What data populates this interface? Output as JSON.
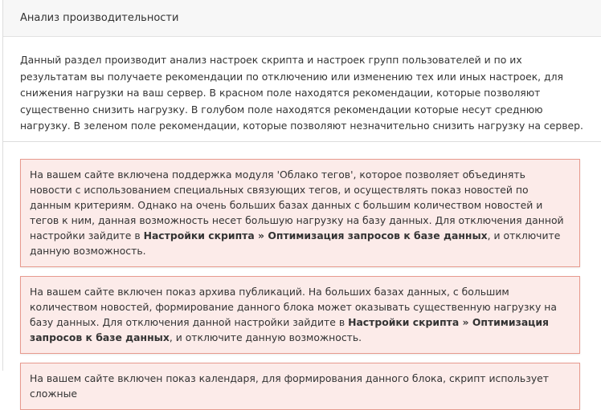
{
  "header": {
    "title": "Анализ производительности"
  },
  "intro": {
    "text": "Данный раздел производит анализ настроек скрипта и настроек групп пользователей и по их результатам вы получаете рекомендации по отключению или изменению тех или иных настроек, для снижения нагрузки на ваш сервер. В красном поле находятся рекомендации, которые позволяют существенно снизить нагрузку. В голубом поле находятся рекомендации которые несут среднюю нагрузку. В зеленом поле рекомендации, которые позволяют незначительно снизить нагрузку на сервер."
  },
  "alerts": [
    {
      "text_before": "На вашем сайте включена поддержка модуля 'Облако тегов', которое позволяет объединять новости с использованием специальных связующих тегов, и осуществлять показ новостей по данным критериям. Однако на очень больших базах данных с большим количеством новостей и тегов к ним, данная возможность несет большую нагрузку на базу данных. Для отключения данной настройки зайдите в ",
      "bold": "Настройки скрипта » Оптимизация запросов к базе данных",
      "text_after": ", и отключите данную возможность."
    },
    {
      "text_before": "На вашем сайте включен показ архива публикаций. На больших базах данных, с большим количеством новостей, формирование данного блока может оказывать существенную нагрузку на базу данных. Для отключения данной настройки зайдите в ",
      "bold": "Настройки скрипта » Оптимизация запросов к базе данных",
      "text_after": ", и отключите данную возможность."
    },
    {
      "text_before": "На вашем сайте включен показ календаря, для формирования данного блока, скрипт использует сложные",
      "bold": "",
      "text_after": ""
    }
  ],
  "colors": {
    "alert_bg": "#fcebe9",
    "alert_border": "#e79a8e",
    "header_bg": "#f7f7f7"
  }
}
